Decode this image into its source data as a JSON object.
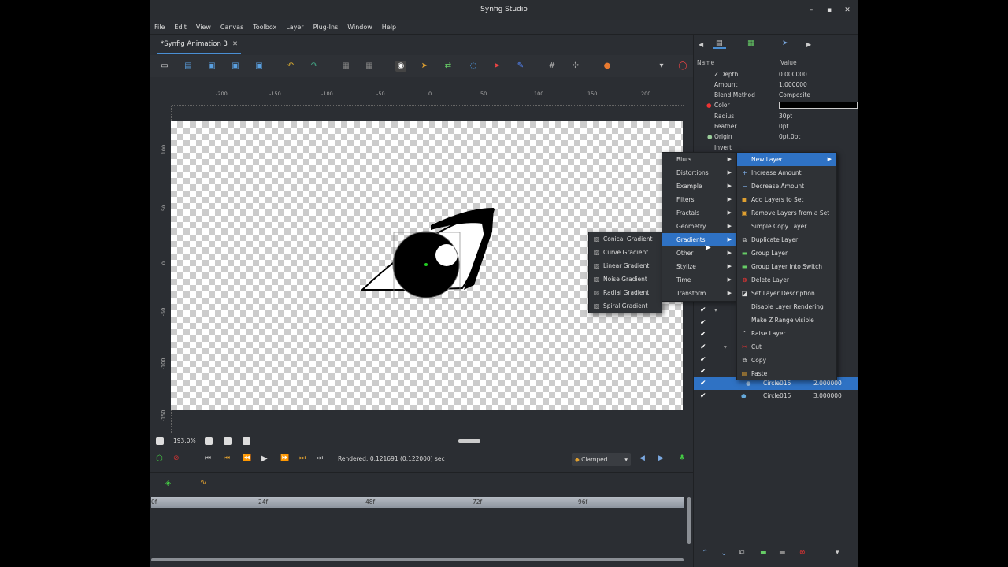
{
  "window": {
    "title": "Synfig Studio",
    "minimize": "–",
    "maximize": "▪",
    "close": "✕"
  },
  "menubar": [
    "File",
    "Edit",
    "View",
    "Canvas",
    "Toolbox",
    "Layer",
    "Plug-Ins",
    "Window",
    "Help"
  ],
  "document_tab": {
    "label": "*Synfig Animation 3",
    "close": "✕"
  },
  "ruler": {
    "h_ticks": [
      "-200",
      "-150",
      "-100",
      "-50",
      "0",
      "50",
      "100",
      "150",
      "200"
    ],
    "v_ticks": [
      "100",
      "50",
      "0",
      "-50",
      "-100",
      "-150"
    ]
  },
  "zoom": {
    "value": "193.0%"
  },
  "playback": {
    "status": "Rendered: 0.121691 (0.122000) sec",
    "interpolation": "Clamped"
  },
  "timeline": {
    "ticks": [
      "0f",
      "24f",
      "48f",
      "72f",
      "96f"
    ]
  },
  "params": {
    "header_name": "Name",
    "header_value": "Value",
    "rows": [
      {
        "name": "Z Depth",
        "value": "0.000000"
      },
      {
        "name": "Amount",
        "value": "1.000000"
      },
      {
        "name": "Blend Method",
        "value": "Composite"
      },
      {
        "name": "Color",
        "value": ""
      },
      {
        "name": "Radius",
        "value": "30pt"
      },
      {
        "name": "Feather",
        "value": "0pt"
      },
      {
        "name": "Origin",
        "value": "0pt,0pt"
      },
      {
        "name": "Invert",
        "value": ""
      }
    ]
  },
  "layers": [
    {
      "name": "Circle015",
      "value": "2.000000",
      "selected": true
    },
    {
      "name": "Circle015",
      "value": "3.000000",
      "selected": false
    }
  ],
  "context_menu": {
    "items": [
      {
        "label": "New Layer",
        "submenu": true,
        "selected": true
      },
      {
        "label": "Increase Amount"
      },
      {
        "label": "Decrease Amount"
      },
      {
        "label": "Add Layers to Set"
      },
      {
        "label": "Remove Layers from a Set"
      },
      {
        "label": "Simple Copy Layer"
      },
      {
        "label": "Duplicate Layer"
      },
      {
        "label": "Group Layer"
      },
      {
        "label": "Group Layer into Switch"
      },
      {
        "label": "Delete Layer"
      },
      {
        "label": "Set Layer Description"
      },
      {
        "label": "Disable Layer Rendering"
      },
      {
        "label": "Make Z Range visible"
      },
      {
        "label": "Raise Layer"
      },
      {
        "label": "Cut"
      },
      {
        "label": "Copy"
      },
      {
        "label": "Paste"
      }
    ]
  },
  "new_layer_menu": [
    "Blurs",
    "Distortions",
    "Example",
    "Filters",
    "Fractals",
    "Geometry",
    "Gradients",
    "Other",
    "Stylize",
    "Time",
    "Transform"
  ],
  "gradients_menu": [
    "Conical Gradient",
    "Curve Gradient",
    "Linear Gradient",
    "Noise Gradient",
    "Radial Gradient",
    "Spiral Gradient"
  ],
  "colors": {
    "accent": "#2f72c4",
    "bg": "#2b2e33",
    "menu": "#2f3236"
  }
}
